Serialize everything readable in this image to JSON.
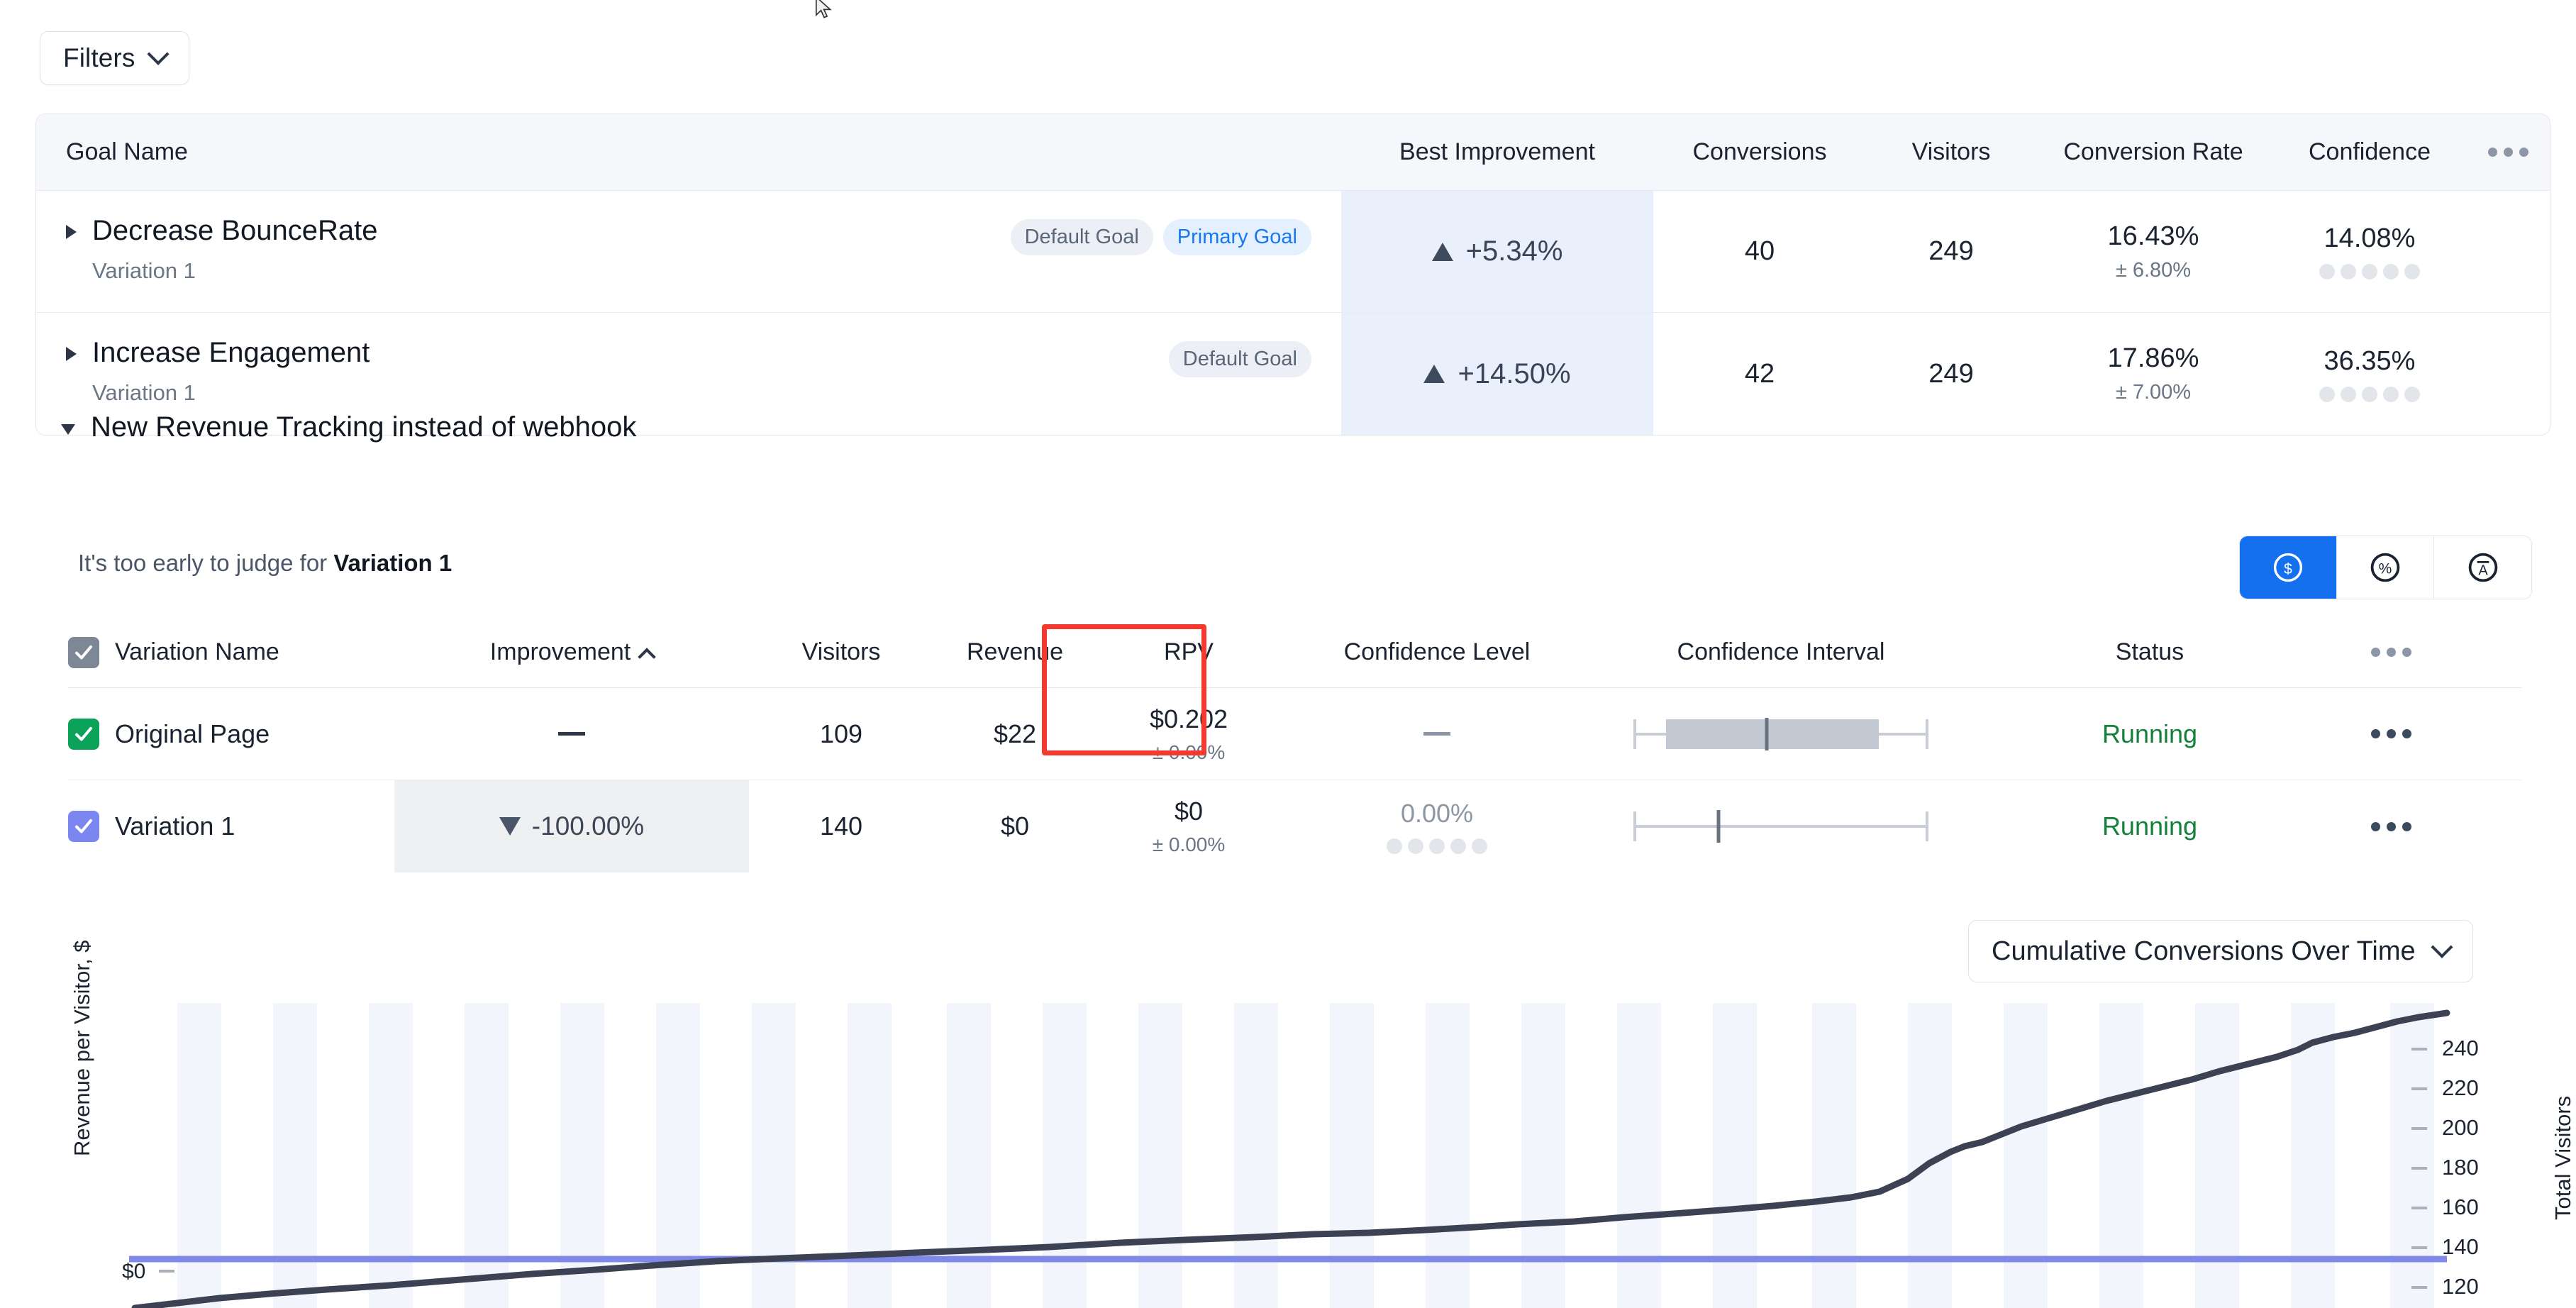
{
  "toolbar": {
    "filters_label": "Filters"
  },
  "goals_table": {
    "columns": [
      "Goal Name",
      "Best Improvement",
      "Conversions",
      "Visitors",
      "Conversion Rate",
      "Confidence"
    ],
    "rows": [
      {
        "name": "Decrease BounceRate",
        "variation": "Variation 1",
        "badges": [
          "Default Goal",
          "Primary Goal"
        ],
        "best_improvement": "+5.34%",
        "direction": "up",
        "conversions": "40",
        "visitors": "249",
        "conversion_rate": "16.43%",
        "conversion_rate_error": "± 6.80%",
        "confidence": "14.08%",
        "confidence_pips": 5
      },
      {
        "name": "Increase Engagement",
        "variation": "Variation 1",
        "badges": [
          "Default Goal"
        ],
        "best_improvement": "+14.50%",
        "direction": "up",
        "conversions": "42",
        "visitors": "249",
        "conversion_rate": "17.86%",
        "conversion_rate_error": "± 7.00%",
        "confidence": "36.35%",
        "confidence_pips": 5
      }
    ]
  },
  "expanded_goal": {
    "title": "New Revenue Tracking instead of webhook",
    "verdict_prefix": "It's too early to judge for ",
    "verdict_subject": "Variation 1",
    "unit_toggle": {
      "options": [
        "currency",
        "percent",
        "absolute"
      ],
      "selected": "currency",
      "currency_symbol": "$",
      "percent_symbol": "%",
      "absolute_symbol": "A"
    },
    "columns": [
      "Variation Name",
      "Improvement",
      "Visitors",
      "Revenue",
      "RPV",
      "Confidence Level",
      "Confidence Interval",
      "Status"
    ],
    "sort_column": "Improvement",
    "sort_direction": "asc",
    "rows": [
      {
        "name": "Original Page",
        "checkbox_color": "#0ba259",
        "improvement": "—",
        "improvement_direction": "none",
        "visitors": "109",
        "revenue": "$22",
        "rpv": "$0.202",
        "rpv_error": "± 0.00%",
        "confidence_level": "—",
        "confidence_pips": 0,
        "status": "Running"
      },
      {
        "name": "Variation 1",
        "checkbox_color": "#7c86f0",
        "improvement": "-100.00%",
        "improvement_direction": "down",
        "visitors": "140",
        "revenue": "$0",
        "rpv": "$0",
        "rpv_error": "± 0.00%",
        "confidence_level": "0.00%",
        "confidence_pips": 5,
        "status": "Running"
      }
    ]
  },
  "chart_dropdown": {
    "selected": "Cumulative Conversions Over Time"
  },
  "chart_data": {
    "type": "line",
    "title": "",
    "ylabel_left": "Revenue per Visitor, $",
    "ylabel_right": "Total Visitors",
    "left_ticks": [
      "$0"
    ],
    "right_ticks": [
      "240",
      "220",
      "200",
      "180",
      "160",
      "140",
      "120"
    ],
    "right_ylim": [
      110,
      250
    ],
    "grid": "vertical-bands",
    "legend": "none",
    "series": [
      {
        "name": "Total Visitors",
        "axis": "right",
        "color": "#3c4253",
        "x": [
          0,
          4,
          8,
          12,
          16,
          20,
          24,
          28,
          32,
          36,
          40,
          44,
          48,
          52,
          56,
          60,
          64,
          68,
          72,
          76,
          80,
          84,
          88,
          92,
          96,
          100
        ],
        "values": [
          112,
          112,
          113,
          113,
          114,
          114,
          115,
          116,
          117,
          118,
          119,
          120,
          121,
          123,
          124,
          126,
          129,
          136,
          160,
          168,
          178,
          190,
          200,
          212,
          226,
          238,
          244
        ]
      },
      {
        "name": "Revenue per Visitor",
        "axis": "left",
        "color": "#7c86f0",
        "x": [
          0,
          100
        ],
        "values": [
          0,
          0
        ]
      }
    ]
  }
}
